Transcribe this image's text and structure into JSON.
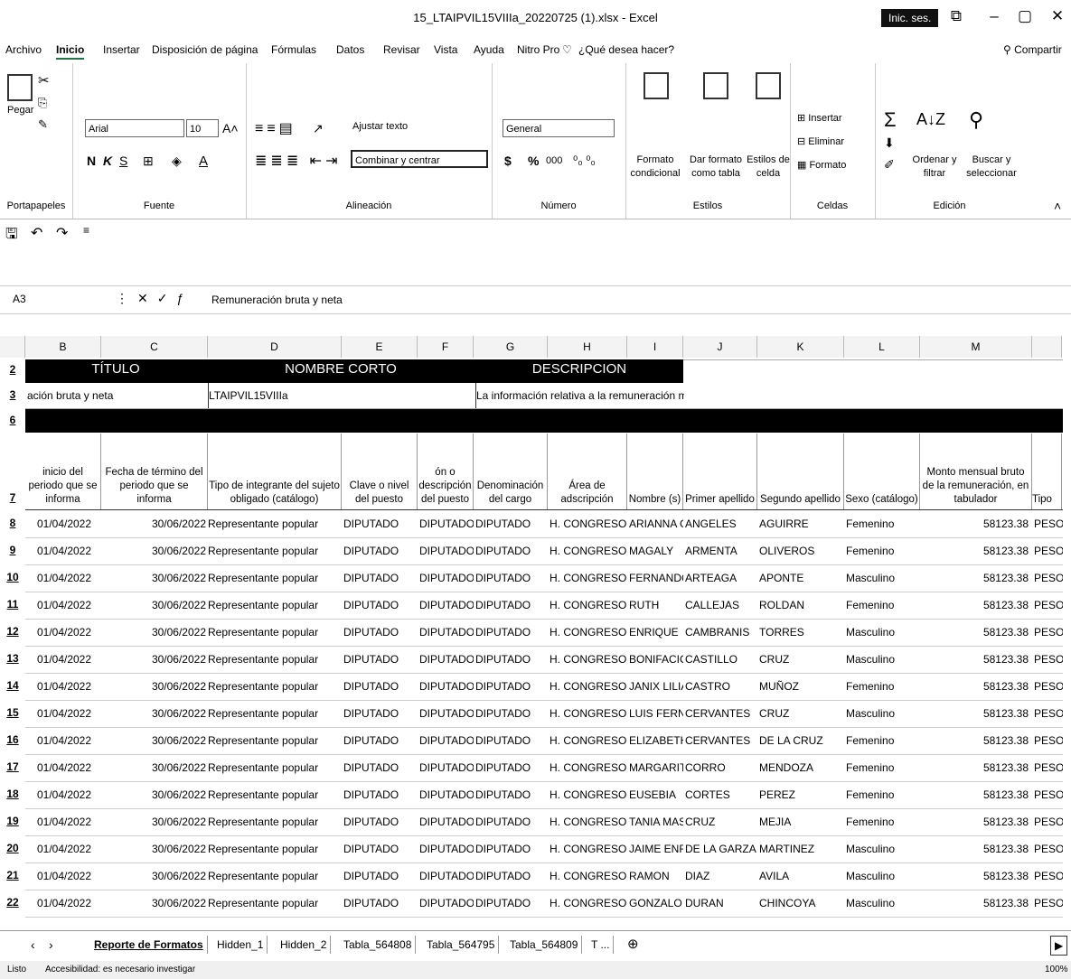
{
  "window": {
    "title": "15_LTAIPVIL15VIIIa_20220725 (1).xlsx - Excel",
    "signin": "Inic. ses.",
    "controls": [
      "⧉",
      "–",
      "▢",
      "✕"
    ]
  },
  "menu": [
    "Archivo",
    "Inicio",
    "Insertar",
    "Disposición de página",
    "Fórmulas",
    "Datos",
    "Revisar",
    "Vista",
    "Ayuda",
    "Nitro Pro"
  ],
  "tell_me": "¿Qué desea hacer?",
  "share": "Compartir",
  "ribbon": {
    "clipboard": {
      "paste": "Pegar",
      "label": "Portapapeles"
    },
    "font": {
      "name": "Arial",
      "size": "10",
      "bold": "N",
      "italic": "K",
      "underline": "S",
      "label": "Fuente"
    },
    "alignment": {
      "wrap": "Ajustar texto",
      "merge": "Combinar y centrar",
      "label": "Alineación"
    },
    "number": {
      "format": "General",
      "currency": "$",
      "percent": "%",
      "thousands": "000",
      "label": "Número"
    },
    "styles": {
      "conditional": "Formato condicional",
      "table": "Dar formato como tabla",
      "cell": "Estilos de celda",
      "label": "Estilos"
    },
    "cells": {
      "insert": "Insertar",
      "delete": "Eliminar",
      "format": "Formato",
      "label": "Celdas"
    },
    "editing": {
      "sort": "Ordenar y filtrar",
      "find": "Buscar y seleccionar",
      "label": "Edición"
    }
  },
  "formula_bar": {
    "name_box": "A3",
    "value": "Remuneración bruta y neta"
  },
  "columns": [
    "B",
    "C",
    "D",
    "E",
    "F",
    "G",
    "H",
    "I",
    "J",
    "K",
    "L",
    "M"
  ],
  "band_row2": {
    "row": "2",
    "titulo": "TÍTULO",
    "nombre_corto": "NOMBRE CORTO",
    "descripcion": "DESCRIPCION"
  },
  "row3": {
    "row": "3",
    "b": "ación bruta y neta",
    "d": "LTAIPVIL15VIIIa",
    "g": "La información relativa a la remuneración me"
  },
  "row6": {
    "row": "6"
  },
  "header_row": {
    "row": "7",
    "cells": [
      "inicio del periodo que se informa",
      "Fecha de término del periodo que se informa",
      "Tipo de integrante del sujeto obligado (catálogo)",
      "Clave o nivel del puesto",
      "ón o descripción del puesto",
      "Denominación del cargo",
      "Área de adscripción",
      "Nombre (s)",
      "Primer apellido",
      "Segundo apellido",
      "Sexo (catálogo)",
      "Monto mensual bruto de la remuneración, en tabulador",
      "Tipo"
    ]
  },
  "rows": [
    {
      "n": "8",
      "b": "01/04/2022",
      "c": "30/06/2022",
      "d": "Representante popular",
      "e": "DIPUTADO",
      "f": "DIPUTADO",
      "g": "DIPUTADO",
      "h": "H. CONGRESO D",
      "i": "ARIANNA G",
      "j": "ANGELES",
      "k": "AGUIRRE",
      "l": "Femenino",
      "m": "58123.38",
      "n2": "PESO"
    },
    {
      "n": "9",
      "b": "01/04/2022",
      "c": "30/06/2022",
      "d": "Representante popular",
      "e": "DIPUTADO",
      "f": "DIPUTADO",
      "g": "DIPUTADO",
      "h": "H. CONGRESO D",
      "i": "MAGALY",
      "j": "ARMENTA",
      "k": "OLIVEROS",
      "l": "Femenino",
      "m": "58123.38",
      "n2": "PESO"
    },
    {
      "n": "10",
      "b": "01/04/2022",
      "c": "30/06/2022",
      "d": "Representante popular",
      "e": "DIPUTADO",
      "f": "DIPUTADO",
      "g": "DIPUTADO",
      "h": "H. CONGRESO D",
      "i": "FERNANDO",
      "j": "ARTEAGA",
      "k": "APONTE",
      "l": "Masculino",
      "m": "58123.38",
      "n2": "PESO"
    },
    {
      "n": "11",
      "b": "01/04/2022",
      "c": "30/06/2022",
      "d": "Representante popular",
      "e": "DIPUTADO",
      "f": "DIPUTADO",
      "g": "DIPUTADO",
      "h": "H. CONGRESO D",
      "i": "RUTH",
      "j": "CALLEJAS",
      "k": "ROLDAN",
      "l": "Femenino",
      "m": "58123.38",
      "n2": "PESO"
    },
    {
      "n": "12",
      "b": "01/04/2022",
      "c": "30/06/2022",
      "d": "Representante popular",
      "e": "DIPUTADO",
      "f": "DIPUTADO",
      "g": "DIPUTADO",
      "h": "H. CONGRESO D",
      "i": "ENRIQUE",
      "j": "CAMBRANIS",
      "k": "TORRES",
      "l": "Masculino",
      "m": "58123.38",
      "n2": "PESO"
    },
    {
      "n": "13",
      "b": "01/04/2022",
      "c": "30/06/2022",
      "d": "Representante popular",
      "e": "DIPUTADO",
      "f": "DIPUTADO",
      "g": "DIPUTADO",
      "h": "H. CONGRESO D",
      "i": "BONIFACIO",
      "j": "CASTILLO",
      "k": "CRUZ",
      "l": "Masculino",
      "m": "58123.38",
      "n2": "PESO"
    },
    {
      "n": "14",
      "b": "01/04/2022",
      "c": "30/06/2022",
      "d": "Representante popular",
      "e": "DIPUTADO",
      "f": "DIPUTADO",
      "g": "DIPUTADO",
      "h": "H. CONGRESO D",
      "i": "JANIX LILIA",
      "j": "CASTRO",
      "k": "MUÑOZ",
      "l": "Femenino",
      "m": "58123.38",
      "n2": "PESO"
    },
    {
      "n": "15",
      "b": "01/04/2022",
      "c": "30/06/2022",
      "d": "Representante popular",
      "e": "DIPUTADO",
      "f": "DIPUTADO",
      "g": "DIPUTADO",
      "h": "H. CONGRESO D",
      "i": "LUIS FERNA",
      "j": "CERVANTES",
      "k": "CRUZ",
      "l": "Masculino",
      "m": "58123.38",
      "n2": "PESO"
    },
    {
      "n": "16",
      "b": "01/04/2022",
      "c": "30/06/2022",
      "d": "Representante popular",
      "e": "DIPUTADO",
      "f": "DIPUTADO",
      "g": "DIPUTADO",
      "h": "H. CONGRESO D",
      "i": "ELIZABETH",
      "j": "CERVANTES",
      "k": "DE LA CRUZ",
      "l": "Femenino",
      "m": "58123.38",
      "n2": "PESO"
    },
    {
      "n": "17",
      "b": "01/04/2022",
      "c": "30/06/2022",
      "d": "Representante popular",
      "e": "DIPUTADO",
      "f": "DIPUTADO",
      "g": "DIPUTADO",
      "h": "H. CONGRESO D",
      "i": "MARGARIT",
      "j": "CORRO",
      "k": "MENDOZA",
      "l": "Femenino",
      "m": "58123.38",
      "n2": "PESO"
    },
    {
      "n": "18",
      "b": "01/04/2022",
      "c": "30/06/2022",
      "d": "Representante popular",
      "e": "DIPUTADO",
      "f": "DIPUTADO",
      "g": "DIPUTADO",
      "h": "H. CONGRESO D",
      "i": "EUSEBIA",
      "j": "CORTES",
      "k": "PEREZ",
      "l": "Femenino",
      "m": "58123.38",
      "n2": "PESO"
    },
    {
      "n": "19",
      "b": "01/04/2022",
      "c": "30/06/2022",
      "d": "Representante popular",
      "e": "DIPUTADO",
      "f": "DIPUTADO",
      "g": "DIPUTADO",
      "h": "H. CONGRESO D",
      "i": "TANIA MAS",
      "j": "CRUZ",
      "k": "MEJIA",
      "l": "Femenino",
      "m": "58123.38",
      "n2": "PESO"
    },
    {
      "n": "20",
      "b": "01/04/2022",
      "c": "30/06/2022",
      "d": "Representante popular",
      "e": "DIPUTADO",
      "f": "DIPUTADO",
      "g": "DIPUTADO",
      "h": "H. CONGRESO D",
      "i": "JAIME ENRI",
      "j": "DE LA GARZA",
      "k": "MARTINEZ",
      "l": "Masculino",
      "m": "58123.38",
      "n2": "PESO"
    },
    {
      "n": "21",
      "b": "01/04/2022",
      "c": "30/06/2022",
      "d": "Representante popular",
      "e": "DIPUTADO",
      "f": "DIPUTADO",
      "g": "DIPUTADO",
      "h": "H. CONGRESO D",
      "i": "RAMON",
      "j": "DIAZ",
      "k": "AVILA",
      "l": "Masculino",
      "m": "58123.38",
      "n2": "PESO"
    },
    {
      "n": "22",
      "b": "01/04/2022",
      "c": "30/06/2022",
      "d": "Representante popular",
      "e": "DIPUTADO",
      "f": "DIPUTADO",
      "g": "DIPUTADO",
      "h": "H. CONGRESO D",
      "i": "GONZALO",
      "j": "DURAN",
      "k": "CHINCOYA",
      "l": "Masculino",
      "m": "58123.38",
      "n2": "PESO"
    }
  ],
  "sheet_tabs": [
    "Reporte de Formatos",
    "Hidden_1",
    "Hidden_2",
    "Tabla_564808",
    "Tabla_564795",
    "Tabla_564809",
    "T ..."
  ],
  "status": {
    "ready": "Listo",
    "accessibility": "Accesibilidad: es necesario investigar",
    "zoom": "100%"
  }
}
